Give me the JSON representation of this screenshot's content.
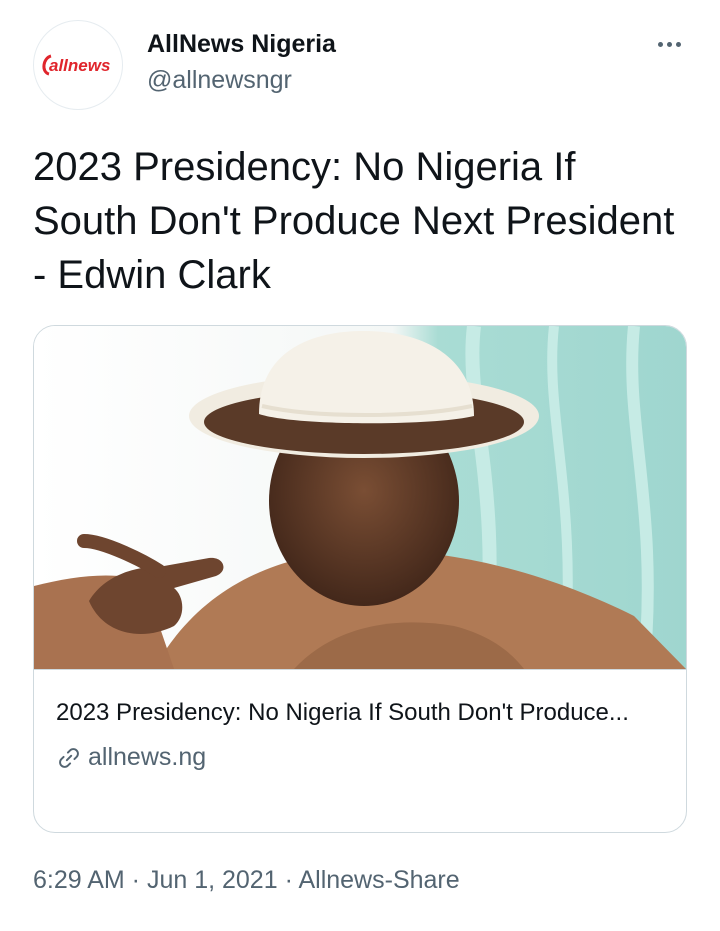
{
  "author": {
    "display_name": "AllNews Nigeria",
    "handle": "@allnewsngr",
    "avatar_logo_text": "allnews"
  },
  "tweet": {
    "text": "2023 Presidency: No Nigeria If South Don't Produce Next President - Edwin Clark"
  },
  "card": {
    "title": "2023 Presidency: No Nigeria If South Don't Produce...",
    "domain": "allnews.ng",
    "image_icon": "photo-of-man-in-white-hat-pointing"
  },
  "meta": {
    "time": "6:29 AM",
    "date": "Jun 1, 2021",
    "source": "Allnews-Share",
    "separator": " · "
  },
  "colors": {
    "brand_red": "#e0252c",
    "secondary_text": "#536471",
    "border": "#cfd9de"
  }
}
